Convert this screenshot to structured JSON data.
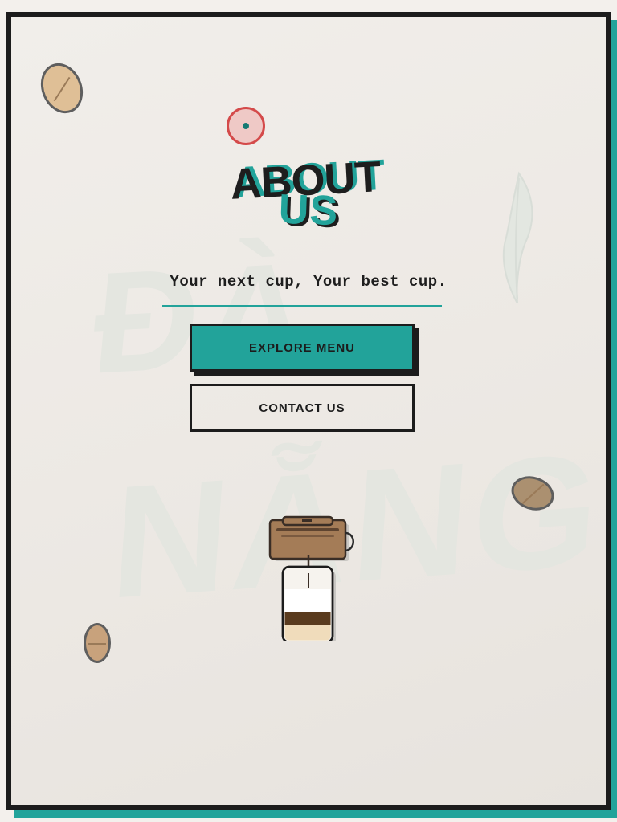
{
  "hero": {
    "title_line1": "ABOUT",
    "title_line2": "US",
    "tagline": "Your next cup, Your best cup."
  },
  "buttons": {
    "primary_label": "EXPLORE MENU",
    "secondary_label": "CONTACT US"
  },
  "background": {
    "watermark_line1": "ĐÀ",
    "watermark_line2": "NẴNG"
  },
  "colors": {
    "accent": "#22a39a",
    "ink": "#1c1c1c",
    "paper": "#f1eeea",
    "cursor": "#d44a4a"
  }
}
